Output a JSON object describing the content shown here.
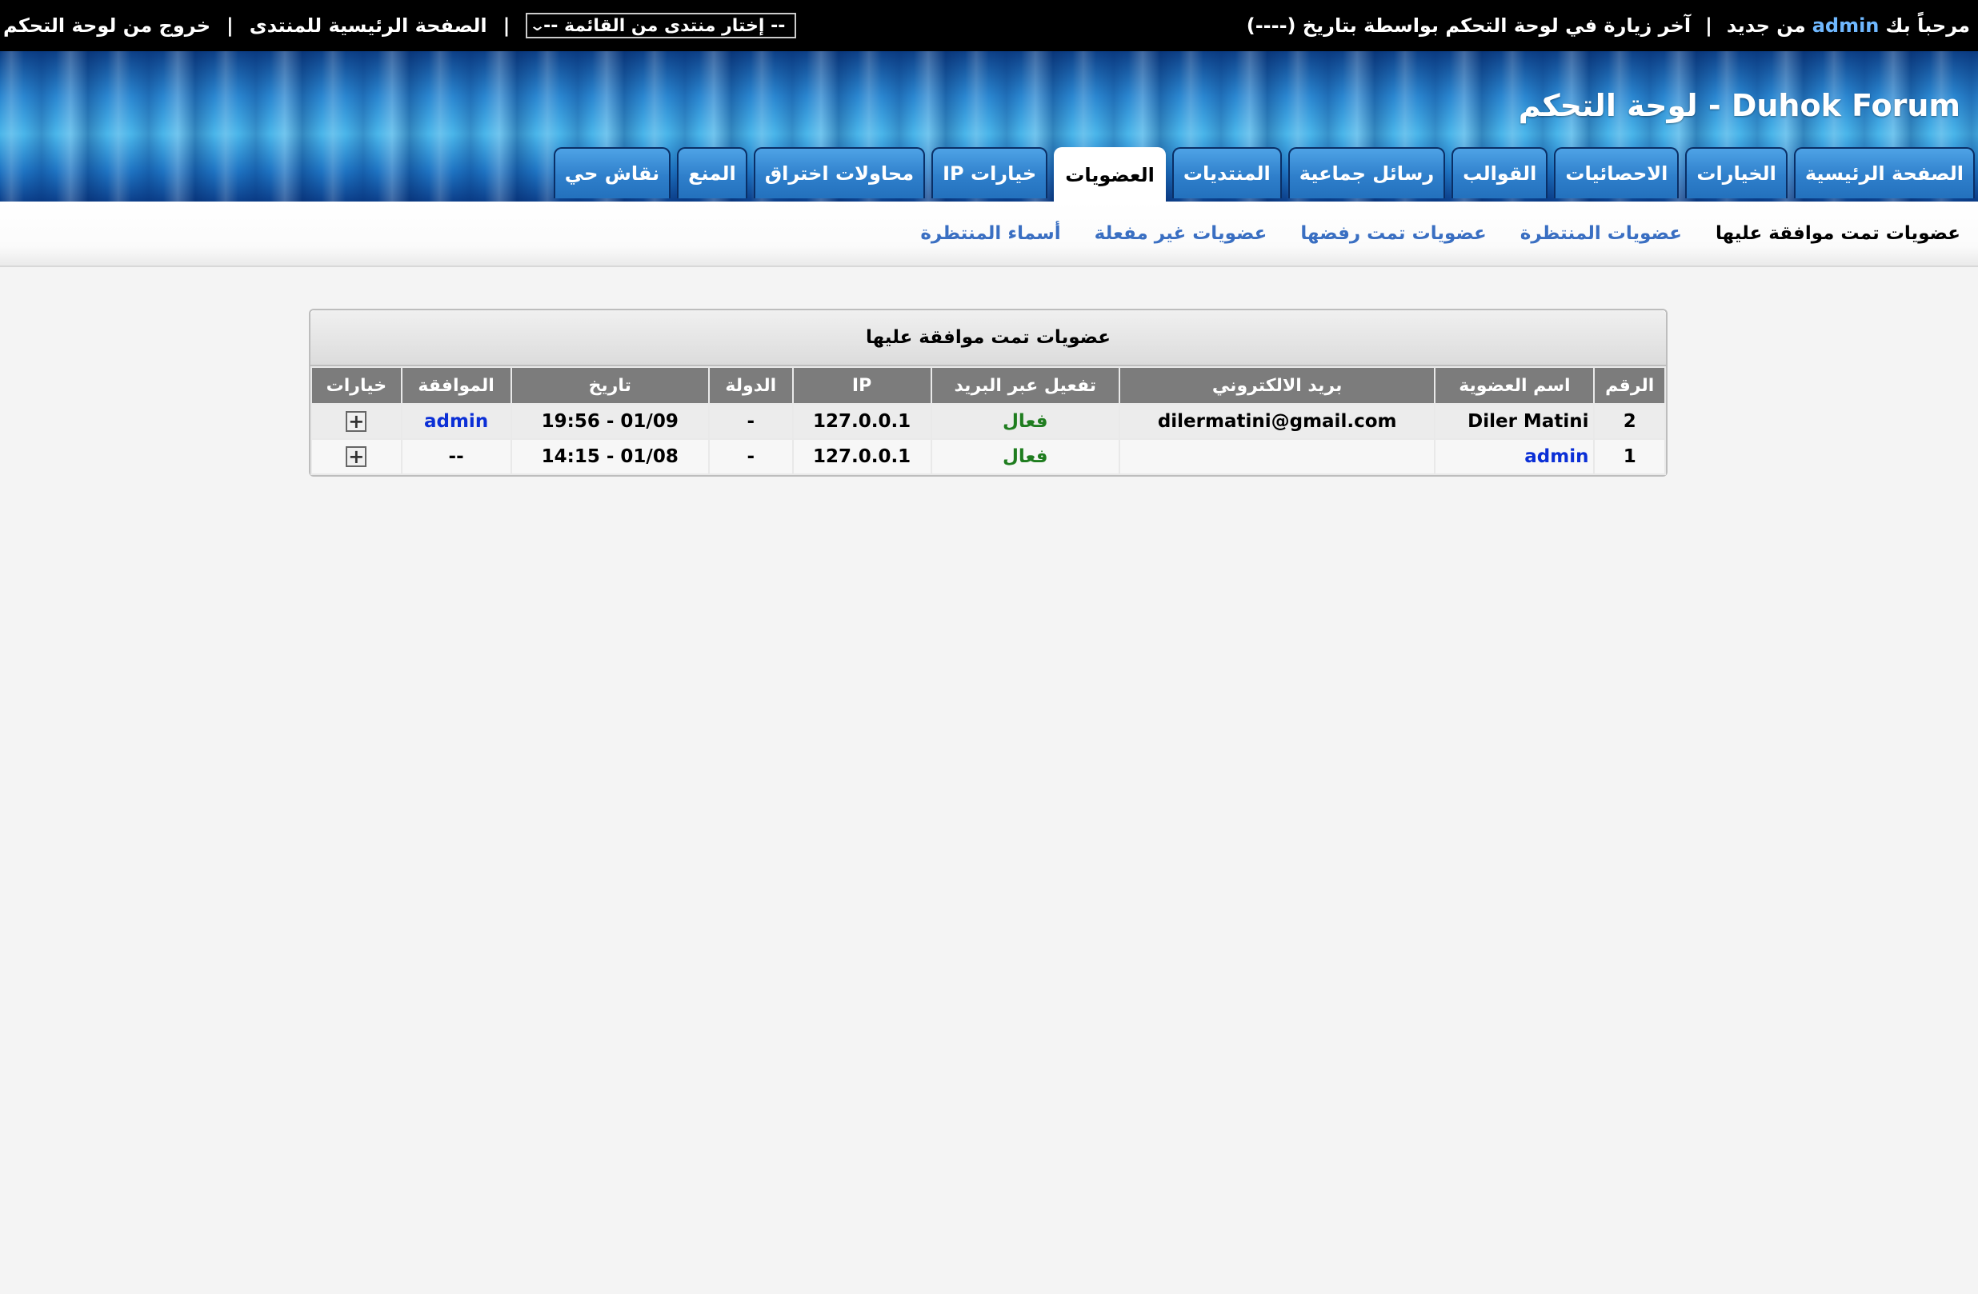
{
  "topbar": {
    "welcome_prefix": "مرحباً بك",
    "username": "admin",
    "welcome_suffix": "من جديد",
    "last_visit": "آخر زيارة في لوحة التحكم بواسطة بتاريخ (----)",
    "forum_select_value": "-- إختار منتدى من القائمة --",
    "forum_home_link": "الصفحة الرئيسية للمنتدى",
    "logout_link": "خروج من لوحة التحكم",
    "separator": "|"
  },
  "header": {
    "title": "Duhok Forum - لوحة التحكم"
  },
  "tabs": [
    {
      "label": "الصفحة الرئيسية",
      "active": false
    },
    {
      "label": "الخيارات",
      "active": false
    },
    {
      "label": "الاحصائيات",
      "active": false
    },
    {
      "label": "القوالب",
      "active": false
    },
    {
      "label": "رسائل جماعية",
      "active": false
    },
    {
      "label": "المنتديات",
      "active": false
    },
    {
      "label": "العضويات",
      "active": true
    },
    {
      "label": "خيارات IP",
      "active": false
    },
    {
      "label": "محاولات اختراق",
      "active": false
    },
    {
      "label": "المنع",
      "active": false
    },
    {
      "label": "نقاش حي",
      "active": false
    }
  ],
  "subnav": [
    {
      "label": "عضويات تمت موافقة عليها",
      "current": true
    },
    {
      "label": "عضويات المنتظرة",
      "current": false
    },
    {
      "label": "عضويات تمت رفضها",
      "current": false
    },
    {
      "label": "عضويات غير مفعلة",
      "current": false
    },
    {
      "label": "أسماء المنتظرة",
      "current": false
    }
  ],
  "panel": {
    "title": "عضويات تمت موافقة عليها",
    "columns": [
      "الرقم",
      "اسم العضوية",
      "بريد الالكتروني",
      "تفعيل عبر البريد",
      "IP",
      "الدولة",
      "تاريخ",
      "الموافقة",
      "خيارات"
    ],
    "rows": [
      {
        "num": "2",
        "name": "Diler Matini",
        "email": "dilermatini@gmail.com",
        "activation": "فعال",
        "ip": "127.0.0.1",
        "country": "-",
        "date": "01/09 - 19:56",
        "approval": "admin"
      },
      {
        "num": "1",
        "name": "admin",
        "email": "",
        "activation": "فعال",
        "ip": "127.0.0.1",
        "country": "-",
        "date": "01/08 - 14:15",
        "approval": "--"
      }
    ]
  },
  "icons": {
    "select_arrow": "chevron-down-icon",
    "row_options": "plus-box-icon"
  },
  "colors": {
    "tab_blue": "#2f7fcb",
    "link_blue": "#0b2fd6",
    "subnav_link": "#3a6fc2",
    "active_green": "#1f7d1f",
    "header_gray": "#7c7c7c"
  }
}
